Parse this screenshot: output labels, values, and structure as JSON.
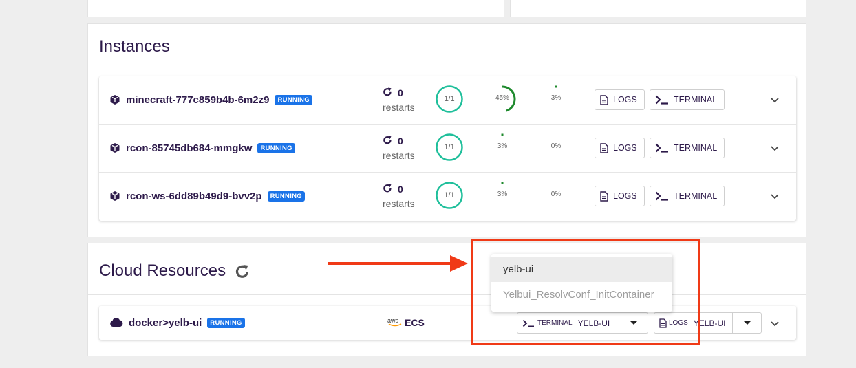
{
  "instances": {
    "title": "Instances",
    "restarts_label": "restarts",
    "logs_label": "LOGS",
    "terminal_label": "TERMINAL",
    "items": [
      {
        "name": "minecraft-777c859b4b-6m2z9",
        "status": "RUNNING",
        "restarts": "0",
        "ready": "1/1",
        "cpu": "45%",
        "cpu_fraction": 0.45,
        "memory": "3%",
        "memory_fraction": 0.03
      },
      {
        "name": "rcon-85745db684-mmgkw",
        "status": "RUNNING",
        "restarts": "0",
        "ready": "1/1",
        "cpu": "3%",
        "cpu_fraction": 0.03,
        "memory": "0%",
        "memory_fraction": 0.0
      },
      {
        "name": "rcon-ws-6dd89b49d9-bvv2p",
        "status": "RUNNING",
        "restarts": "0",
        "ready": "1/1",
        "cpu": "3%",
        "cpu_fraction": 0.03,
        "memory": "0%",
        "memory_fraction": 0.0
      }
    ]
  },
  "cloud": {
    "title": "Cloud Resources",
    "resource": {
      "name": "docker>yelb-ui",
      "status": "RUNNING",
      "provider": "aws",
      "service": "ECS",
      "terminal_label": "TERMINAL",
      "terminal_selected": "YELB-UI",
      "logs_label": "LOGS",
      "logs_selected": "YELB-UI"
    }
  },
  "dropdown": {
    "options": [
      "yelb-ui",
      "Yelbui_ResolvConf_InitContainer"
    ]
  },
  "colors": {
    "accent": "#1a73e8",
    "ring": "#1fbf9b",
    "gauge": "#1f8a2e",
    "annotation": "#f03a17",
    "text": "#2d1a4a"
  }
}
